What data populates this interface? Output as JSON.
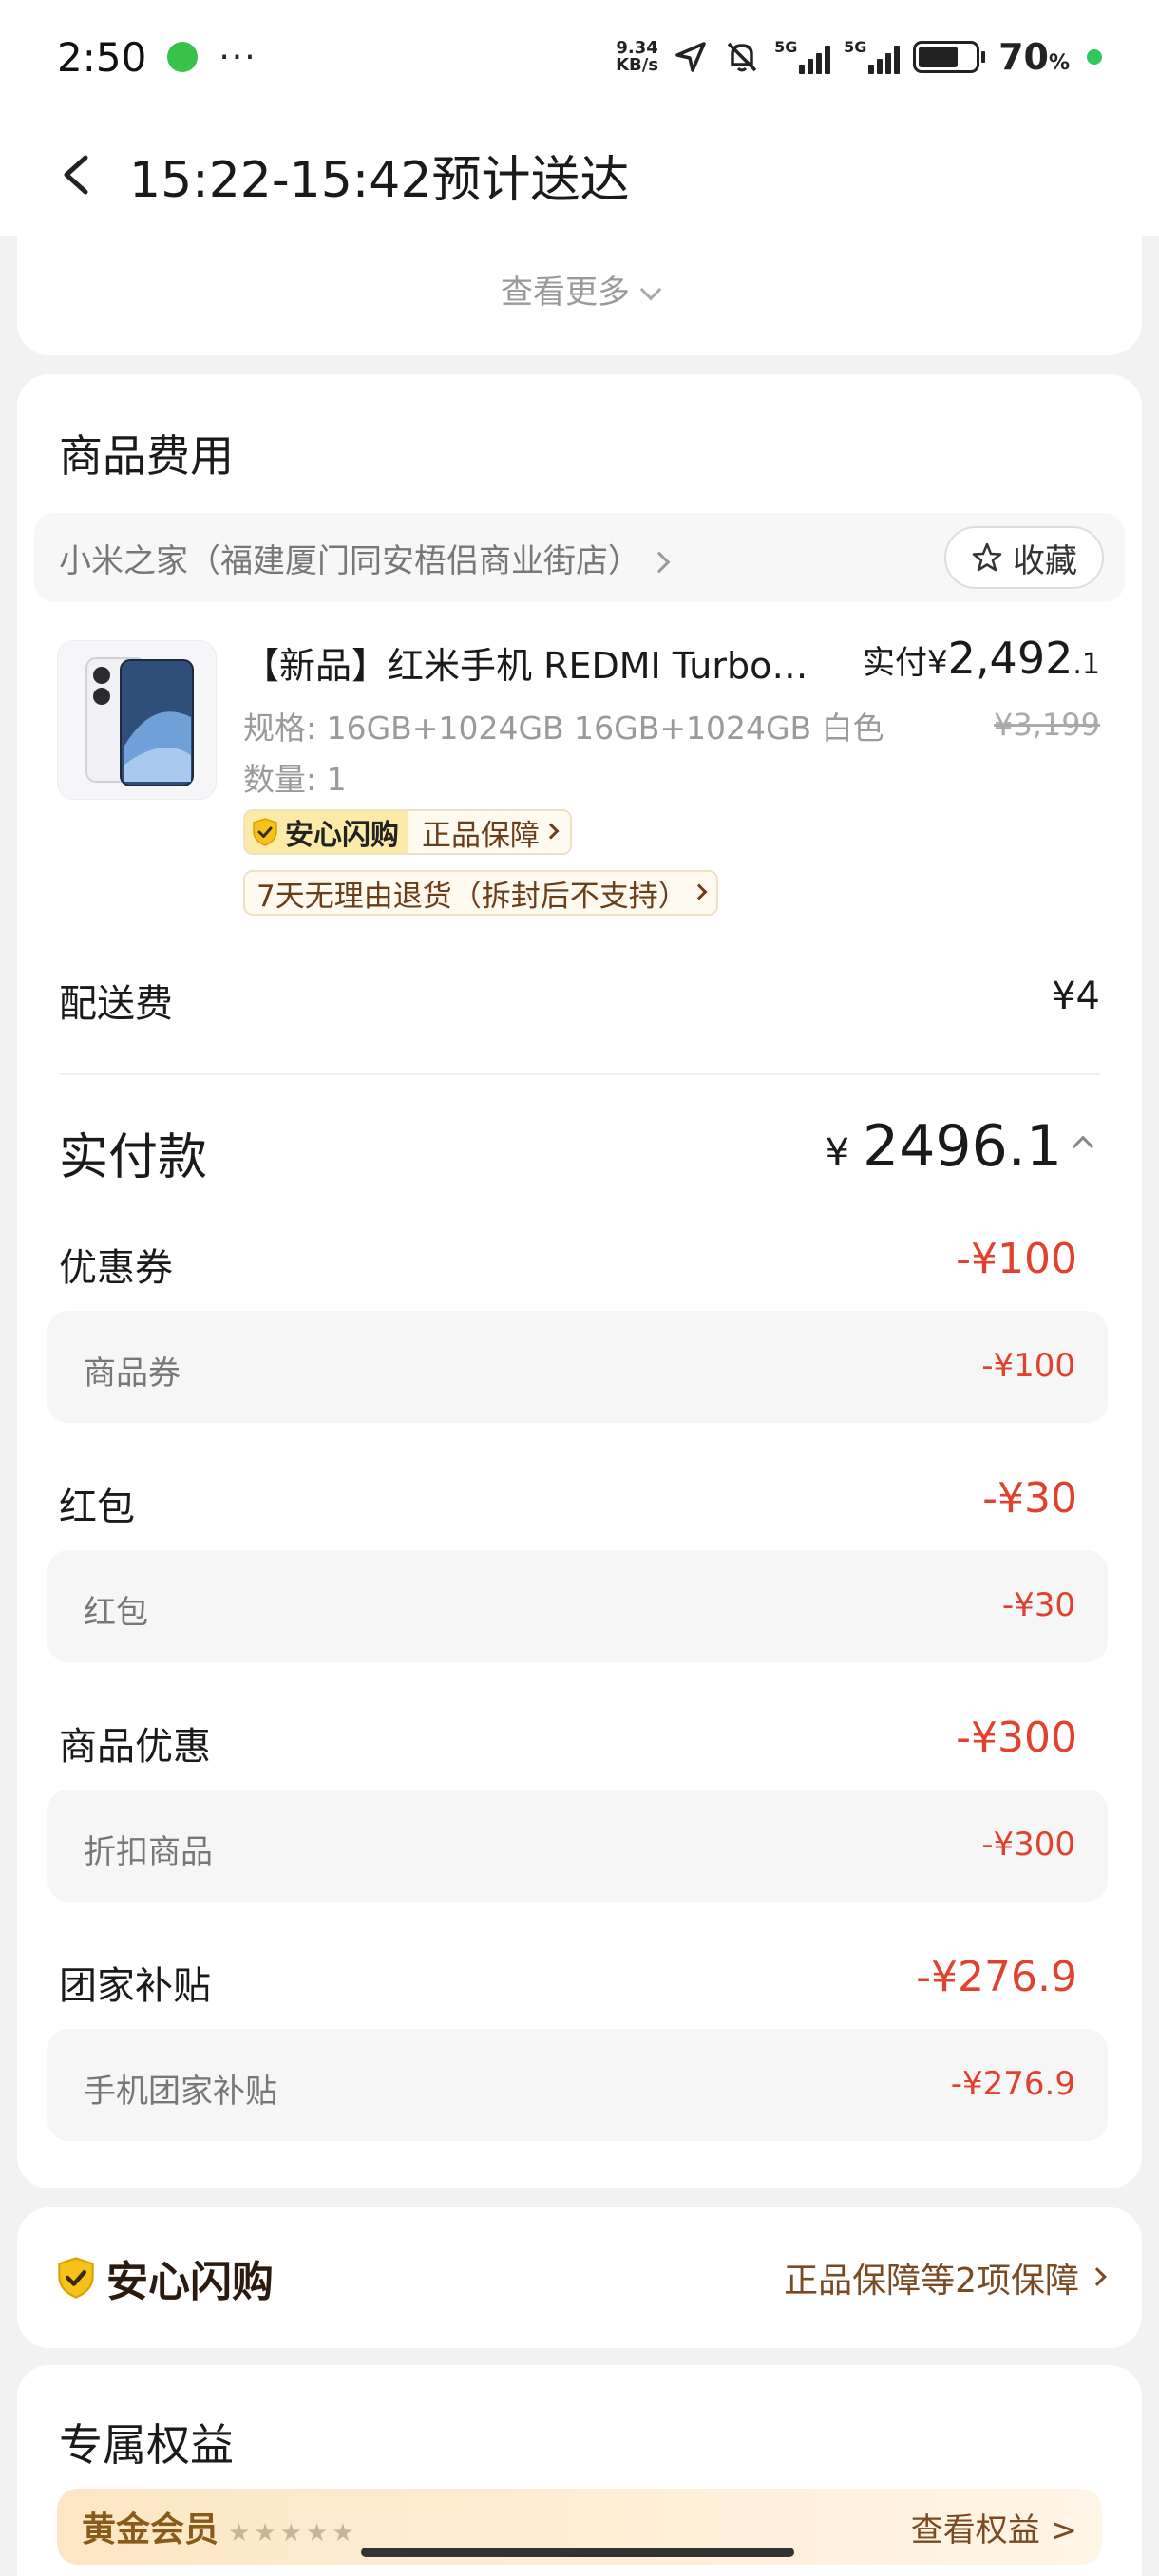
{
  "status_bar": {
    "time": "2:50",
    "speed_value": "9.34",
    "speed_unit": "KB/s",
    "network_1": "5G",
    "network_2": "5G",
    "battery_percent": "70",
    "battery_level": 0.7,
    "percent_sign": "%"
  },
  "nav": {
    "title": "15:22-15:42预计送达"
  },
  "order_top": {
    "see_more": "查看更多"
  },
  "fee": {
    "section_title": "商品费用",
    "store_name": "小米之家（福建厦门同安梧侣商业街店）",
    "favorite_label": "收藏",
    "product": {
      "name": "【新品】红米手机 REDMI Turbo…",
      "spec": "规格: 16GB+1024GB 16GB+1024GB 白色",
      "quantity": "数量: 1",
      "paid_prefix": "实付",
      "paid_currency": "¥",
      "paid_main": "2,492",
      "paid_decimal": ".1",
      "original_price": "¥3,199",
      "tag_anxin": "安心闪购",
      "tag_guarantee": "正品保障",
      "tag_return": "7天无理由退货（拆封后不支持）"
    },
    "shipping_label": "配送费",
    "shipping_value": "¥4",
    "total_label": "实付款",
    "total_currency": "¥",
    "total_value": "2496.1",
    "discounts": [
      {
        "label": "优惠券",
        "value": "-¥100",
        "sub_label": "商品券",
        "sub_value": "-¥100"
      },
      {
        "label": "红包",
        "value": "-¥30",
        "sub_label": "红包",
        "sub_value": "-¥30"
      },
      {
        "label": "商品优惠",
        "value": "-¥300",
        "sub_label": "折扣商品",
        "sub_value": "-¥300"
      },
      {
        "label": "团家补贴",
        "value": "-¥276.9",
        "sub_label": "手机团家补贴",
        "sub_value": "-¥276.9"
      }
    ]
  },
  "anxin": {
    "brand": "安心闪购",
    "link": "正品保障等2项保障"
  },
  "rights": {
    "title": "专属权益",
    "member": "黄金会员",
    "member_stars": "★★★★★",
    "view": "查看权益 >"
  },
  "colors": {
    "discount_red": "#e0422f",
    "brand_brown": "#7a4a22",
    "anxin_yellow": "#fde9a8"
  }
}
